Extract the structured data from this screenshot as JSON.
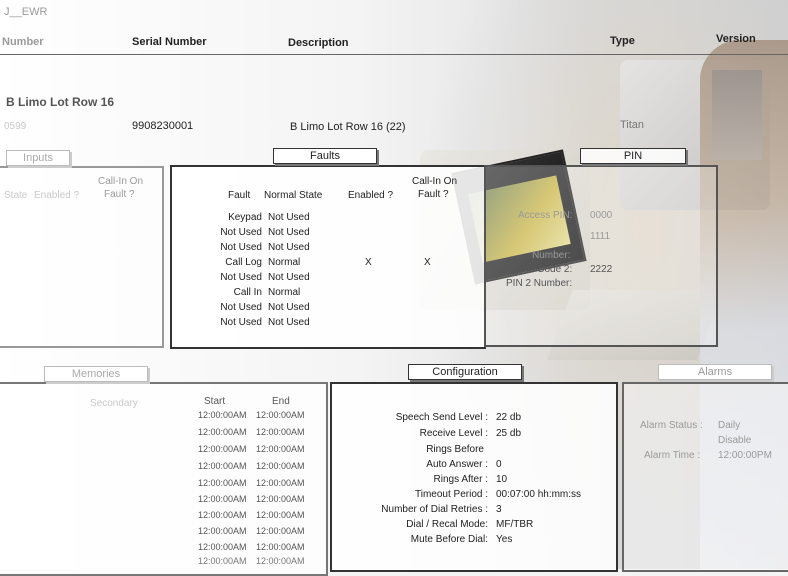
{
  "window_title": "J__EWR",
  "columns": {
    "number": "Number",
    "serial_number": "Serial Number",
    "description": "Description",
    "type": "Type",
    "version": "Version"
  },
  "record": {
    "heading": "B Limo Lot Row 16",
    "number_partial": "0599",
    "serial": "9908230001",
    "description": "B Limo Lot Row 16  (22)",
    "type": "Titan"
  },
  "left_panel": {
    "tab": "Inputs",
    "header_state": "State",
    "header_enabled": "Enabled ?",
    "header_callin": "Call-In On",
    "header_callin2": "Fault ?"
  },
  "faults": {
    "tab": "Faults",
    "header_fault": "Fault",
    "header_normal_state": "Normal State",
    "header_enabled": "Enabled ?",
    "header_callin": "Call-In On",
    "header_callin2": "Fault ?",
    "rows": [
      {
        "fault": "Keypad",
        "state": "Not Used",
        "enabled": "",
        "callin": ""
      },
      {
        "fault": "Not Used",
        "state": "Not Used",
        "enabled": "",
        "callin": ""
      },
      {
        "fault": "Not Used",
        "state": "Not Used",
        "enabled": "",
        "callin": ""
      },
      {
        "fault": "Call Log",
        "state": "Normal",
        "enabled": "X",
        "callin": "X"
      },
      {
        "fault": "Not Used",
        "state": "Not Used",
        "enabled": "",
        "callin": ""
      },
      {
        "fault": "Call In",
        "state": "Normal",
        "enabled": "",
        "callin": ""
      },
      {
        "fault": "Not Used",
        "state": "Not Used",
        "enabled": "",
        "callin": ""
      },
      {
        "fault": "Not Used",
        "state": "Not Used",
        "enabled": "",
        "callin": ""
      }
    ]
  },
  "pin": {
    "tab": "PIN",
    "access_label": "Access PIN:",
    "access_value": "0000",
    "value2": "1111",
    "number_label": "Number:",
    "pin_code2_label": "Pin Code 2:",
    "pin_code2_value": "2222",
    "pin2_number_label": "PIN 2 Number:"
  },
  "memories": {
    "tab": "Memories",
    "secondary": "Secondary",
    "header_start": "Start",
    "header_end": "End",
    "rows": [
      {
        "start": "12:00:00AM",
        "end": "12:00:00AM"
      },
      {
        "start": "12:00:00AM",
        "end": "12:00:00AM"
      },
      {
        "start": "12:00:00AM",
        "end": "12:00:00AM"
      },
      {
        "start": "12:00:00AM",
        "end": "12:00:00AM"
      },
      {
        "start": "12:00:00AM",
        "end": "12:00:00AM"
      },
      {
        "start": "12:00:00AM",
        "end": "12:00:00AM"
      },
      {
        "start": "12:00:00AM",
        "end": "12:00:00AM"
      },
      {
        "start": "12:00:00AM",
        "end": "12:00:00AM"
      },
      {
        "start": "12:00:00AM",
        "end": "12:00:00AM"
      },
      {
        "start": "12:00:00AM",
        "end": "12:00:00AM"
      }
    ]
  },
  "configuration": {
    "tab": "Configuration",
    "rows": [
      {
        "label": "Speech Send Level :",
        "value": "22  db"
      },
      {
        "label": "Receive Level :",
        "value": "25  db"
      },
      {
        "label": "Rings Before",
        "value": ""
      },
      {
        "label": "Auto Answer :",
        "value": "0"
      },
      {
        "label": "Rings After :",
        "value": "10"
      },
      {
        "label": "Timeout Period :",
        "value": "00:07:00   hh:mm:ss"
      },
      {
        "label": "Number of Dial Retries :",
        "value": "3"
      },
      {
        "label": "Dial / Recal Mode:",
        "value": "MF/TBR"
      },
      {
        "label": "Mute Before Dial:",
        "value": "Yes"
      }
    ]
  },
  "alarms": {
    "tab": "Alarms",
    "status_label": "Alarm Status :",
    "status_value": "Daily",
    "status_value2": "Disable",
    "time_label": "Alarm Time :",
    "time_value": "12:00:00PM"
  }
}
